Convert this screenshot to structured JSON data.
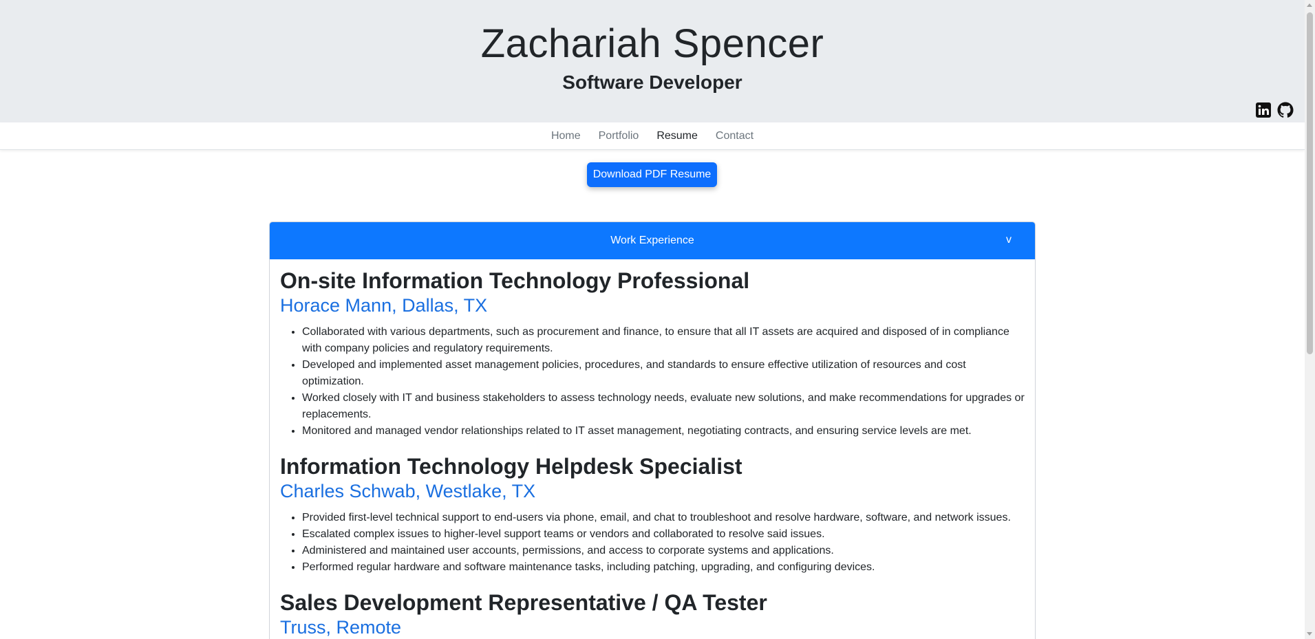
{
  "header": {
    "name": "Zachariah Spencer",
    "role": "Software Developer",
    "social": [
      {
        "icon": "linkedin-icon"
      },
      {
        "icon": "github-icon"
      }
    ]
  },
  "nav": {
    "items": [
      {
        "label": "Home"
      },
      {
        "label": "Portfolio"
      },
      {
        "label": "Resume",
        "active": true
      },
      {
        "label": "Contact"
      }
    ]
  },
  "download_button": "Download PDF Resume",
  "section": {
    "title": "Work Experience",
    "toggle": "v",
    "jobs": [
      {
        "title": "On-site Information Technology Professional",
        "company": "Horace Mann, Dallas, TX",
        "bullets": [
          "Collaborated with various departments, such as procurement and finance, to ensure that all IT assets are acquired and disposed of in compliance with company policies and regulatory requirements.",
          "Developed and implemented asset management policies, procedures, and standards to ensure effective utilization of resources and cost optimization.",
          "Worked closely with IT and business stakeholders to assess technology needs, evaluate new solutions, and make recommendations for upgrades or replacements.",
          "Monitored and managed vendor relationships related to IT asset management, negotiating contracts, and ensuring service levels are met."
        ]
      },
      {
        "title": "Information Technology Helpdesk Specialist",
        "company": "Charles Schwab, Westlake, TX",
        "bullets": [
          "Provided first-level technical support to end-users via phone, email, and chat to troubleshoot and resolve hardware, software, and network issues.",
          "Escalated complex issues to higher-level support teams or vendors and collaborated to resolve said issues.",
          "Administered and maintained user accounts, permissions, and access to corporate systems and applications.",
          "Performed regular hardware and software maintenance tasks, including patching, upgrading, and configuring devices."
        ]
      },
      {
        "title": "Sales Development Representative / QA Tester",
        "company": "Truss, Remote",
        "bullets": []
      }
    ]
  }
}
